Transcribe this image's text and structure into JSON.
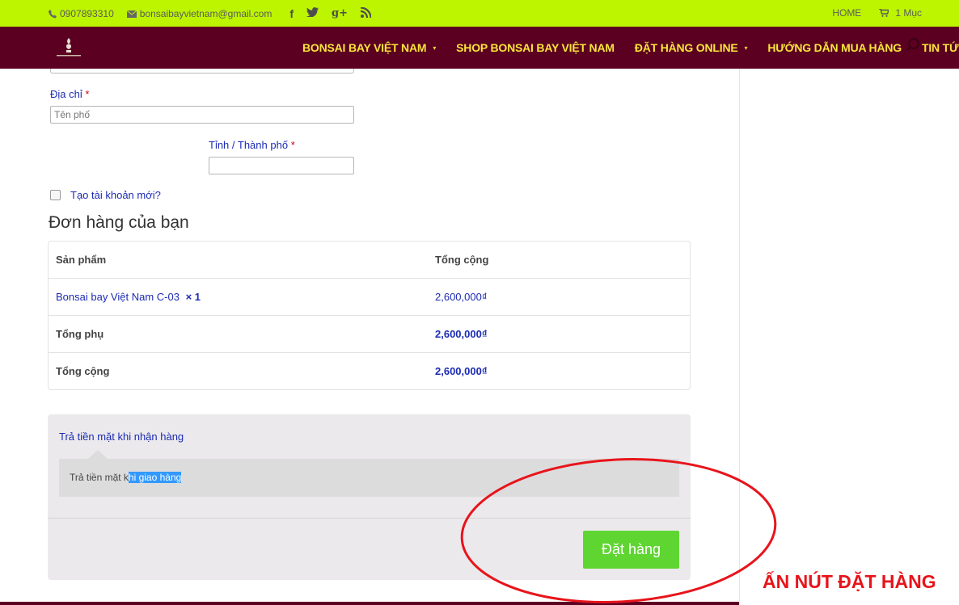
{
  "topbar": {
    "phone": "0907893310",
    "email": "bonsaibayvietnam@gmail.com",
    "social": [
      "f",
      "twitter-icon",
      "g+",
      "rss-icon"
    ],
    "home": "HOME",
    "cart": "1 Mục"
  },
  "nav": {
    "items": [
      {
        "label": "BONSAI BAY VIỆT NAM",
        "caret": "▾"
      },
      {
        "label": "SHOP BONSAI BAY VIỆT NAM",
        "caret": ""
      },
      {
        "label": "ĐẶT HÀNG ONLINE",
        "caret": "▾"
      },
      {
        "label": "HƯỚNG DẪN MUA HÀNG",
        "caret": ""
      },
      {
        "label": "TIN TỨC",
        "caret": "▾"
      }
    ]
  },
  "form": {
    "address_label": "Địa chỉ",
    "address_placeholder": "Tên phố",
    "city_label": "Tỉnh / Thành phố",
    "required_mark": "*",
    "create_account": "Tạo tài khoản mới?"
  },
  "order": {
    "title": "Đơn hàng của bạn",
    "headers": [
      "Sản phẩm",
      "Tổng cộng"
    ],
    "product_name": "Bonsai bay Việt Nam C-03",
    "product_qty": "× 1",
    "product_price": "2,600,000₫",
    "subtotal_label": "Tổng phụ",
    "subtotal_value": "2,600,000₫",
    "total_label": "Tổng cộng",
    "total_value": "2,600,000₫"
  },
  "payment": {
    "method": "Trả tiền mặt khi nhận hàng",
    "desc_plain": "Trả tiền mặt k",
    "desc_highlight": "hi giao hàng",
    "place_order": "Đặt hàng"
  },
  "annotation": {
    "text": "ẤN NÚT ĐẶT HÀNG",
    "color": "#e8141b"
  },
  "colors": {
    "topbar": "#bdf400",
    "nav": "#5c0021",
    "nav_text": "#f7e53b",
    "link": "#1c2bb3",
    "button": "#5fd532"
  }
}
